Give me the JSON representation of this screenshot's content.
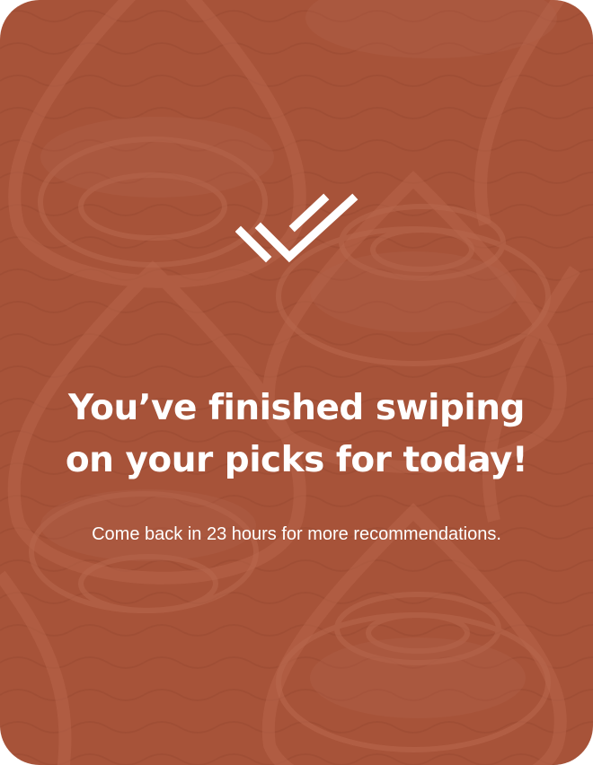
{
  "card": {
    "background_color": "#a75339",
    "pattern_color": "#b9684e",
    "icon": "double-check-icon",
    "title_line_1": "You’ve finished swiping",
    "title_line_2": "on your picks for today!",
    "subtitle": "Come back in 23 hours for more recommendations."
  }
}
